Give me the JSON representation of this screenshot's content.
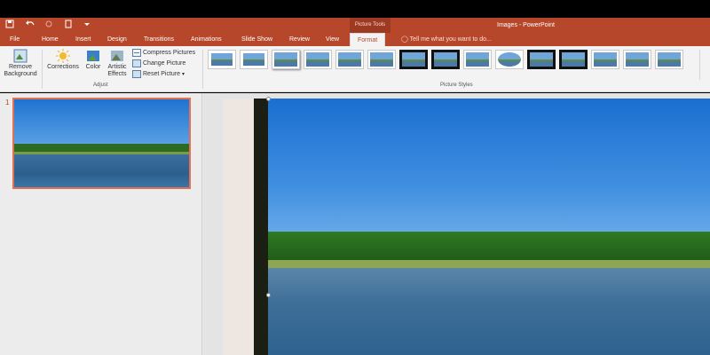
{
  "quick_access": {
    "save_icon": "save-icon",
    "undo_icon": "undo-icon",
    "redo_icon": "redo-icon",
    "customize_icon": "customize-qat-icon"
  },
  "title_bar": {
    "context_tab": "Picture Tools",
    "document_title": "Images - PowerPoint"
  },
  "tabs": [
    {
      "label": "File"
    },
    {
      "label": "Home"
    },
    {
      "label": "Insert"
    },
    {
      "label": "Design"
    },
    {
      "label": "Transitions"
    },
    {
      "label": "Animations"
    },
    {
      "label": "Slide Show"
    },
    {
      "label": "Review"
    },
    {
      "label": "View"
    },
    {
      "label": "Format"
    }
  ],
  "tell_me": "Tell me what you want to do...",
  "ribbon": {
    "remove_background": [
      "Remove",
      "Background"
    ],
    "corrections": "Corrections",
    "color": "Color",
    "artistic_effects": [
      "Artistic",
      "Effects"
    ],
    "compress_pictures": "Compress Pictures",
    "change_picture": "Change Picture",
    "reset_picture": "Reset Picture",
    "adjust_group": "Adjust",
    "picture_styles_group": "Picture Styles"
  },
  "thumbnail": {
    "slide_number": "1"
  },
  "colors": {
    "accent": "#b7472a",
    "ribbon_bg": "#f3f3f3",
    "selection": "#e36f55"
  }
}
